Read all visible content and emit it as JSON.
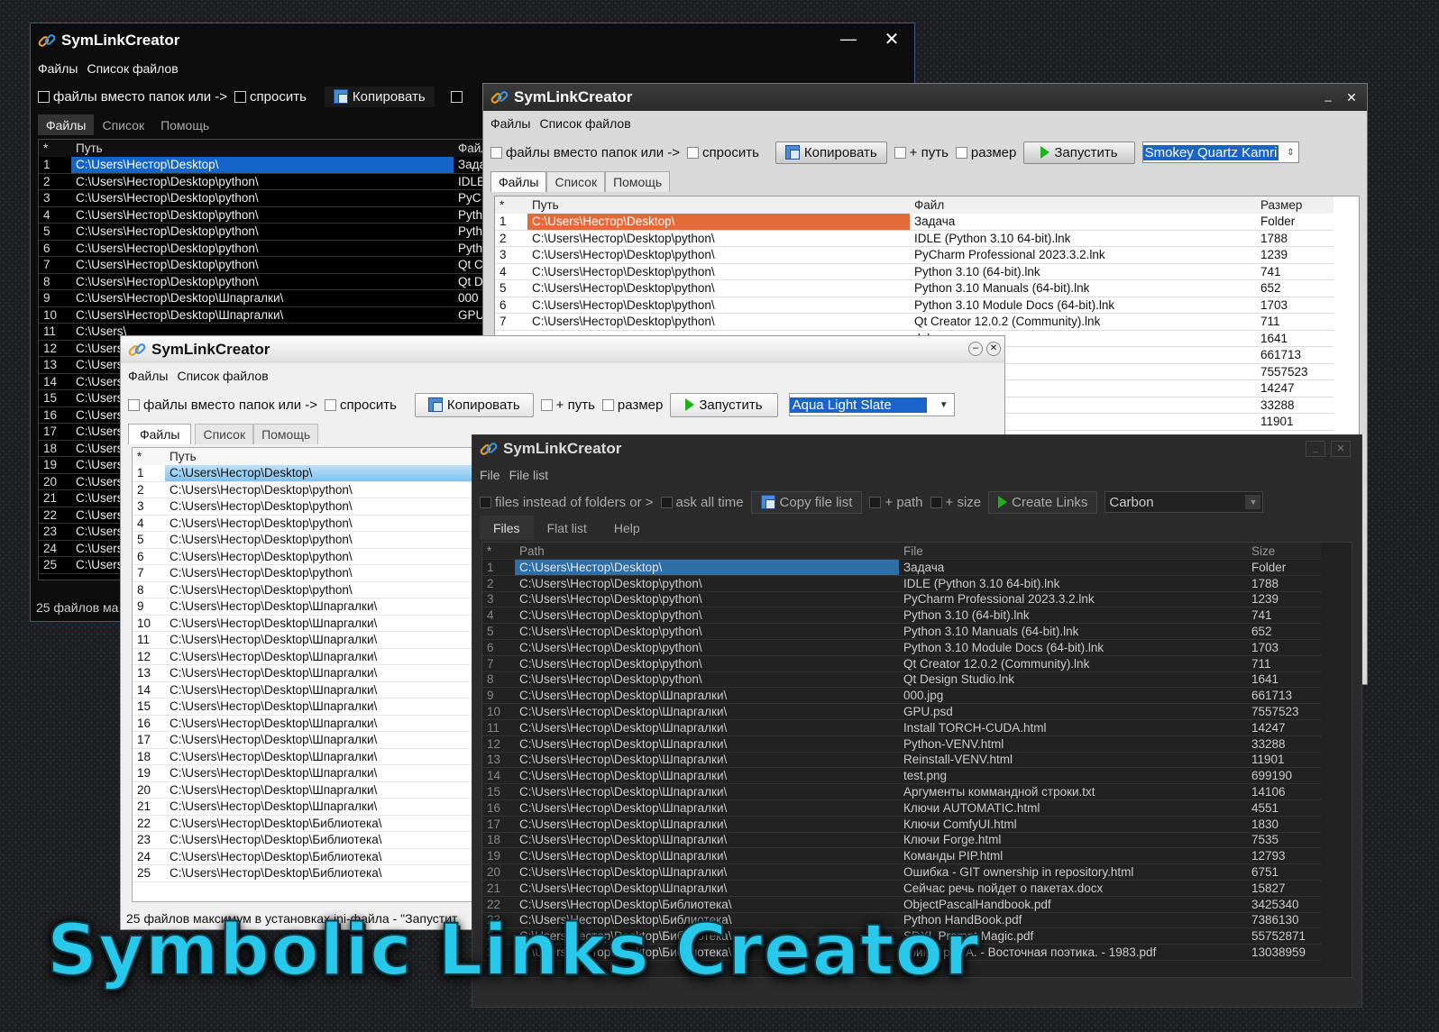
{
  "app_title": "SymLinkCreator",
  "watermark": "Symbolic Links Creator",
  "ru": {
    "menu": [
      "Файлы",
      "Список файлов"
    ],
    "files_instead": "файлы вместо папок или ->",
    "ask": "спросить",
    "copy": "Копировать",
    "plus_path": "+ путь",
    "size": "размер",
    "run": "Запустить",
    "tabs": [
      "Файлы",
      "Список",
      "Помощь"
    ],
    "col_path": "Путь",
    "col_file": "Файл",
    "col_size": "Размер"
  },
  "w1": {
    "paths": [
      "C:\\Users\\Нестор\\Desktop\\",
      "C:\\Users\\Нестор\\Desktop\\python\\",
      "C:\\Users\\Нестор\\Desktop\\python\\",
      "C:\\Users\\Нестор\\Desktop\\python\\",
      "C:\\Users\\Нестор\\Desktop\\python\\",
      "C:\\Users\\Нестор\\Desktop\\python\\",
      "C:\\Users\\Нестор\\Desktop\\python\\",
      "C:\\Users\\Нестор\\Desktop\\python\\",
      "C:\\Users\\Нестор\\Desktop\\Шпаргалки\\",
      "C:\\Users\\Нестор\\Desktop\\Шпаргалки\\",
      "C:\\Users\\",
      "C:\\Users\\",
      "C:\\Users\\",
      "C:\\Users\\",
      "C:\\Users\\",
      "C:\\Users\\",
      "C:\\Users\\",
      "C:\\Users\\",
      "C:\\Users\\",
      "C:\\Users\\",
      "C:\\Users\\",
      "C:\\Users\\",
      "C:\\Users\\",
      "C:\\Users\\",
      "C:\\Users\\"
    ],
    "files": [
      "Зада",
      "IDLE",
      "PyC",
      "Pyth",
      "Pyth",
      "Pyth",
      "Qt C",
      "Qt D",
      "000",
      "GPU",
      "",
      "",
      "",
      "",
      "",
      "",
      "",
      "",
      "",
      "",
      "",
      "",
      "",
      "",
      ""
    ],
    "status": "25 файлов ма"
  },
  "w2": {
    "theme": "Smokey Quartz Kamri",
    "rows": [
      {
        "n": "1",
        "path": "C:\\Users\\Нестор\\Desktop\\",
        "file": "Задача",
        "size": "Folder"
      },
      {
        "n": "2",
        "path": "C:\\Users\\Нестор\\Desktop\\python\\",
        "file": "IDLE (Python 3.10 64-bit).lnk",
        "size": "1788"
      },
      {
        "n": "3",
        "path": "C:\\Users\\Нестор\\Desktop\\python\\",
        "file": "PyCharm Professional 2023.3.2.lnk",
        "size": "1239"
      },
      {
        "n": "4",
        "path": "C:\\Users\\Нестор\\Desktop\\python\\",
        "file": "Python 3.10 (64-bit).lnk",
        "size": "741"
      },
      {
        "n": "5",
        "path": "C:\\Users\\Нестор\\Desktop\\python\\",
        "file": "Python 3.10 Manuals (64-bit).lnk",
        "size": "652"
      },
      {
        "n": "6",
        "path": "C:\\Users\\Нестор\\Desktop\\python\\",
        "file": "Python 3.10 Module Docs (64-bit).lnk",
        "size": "1703"
      },
      {
        "n": "7",
        "path": "C:\\Users\\Нестор\\Desktop\\python\\",
        "file": "Qt Creator 12.0.2 (Community).lnk",
        "size": "711"
      },
      {
        "n": "",
        "path": "",
        "file": ".lnk",
        "size": "1641"
      },
      {
        "n": "",
        "path": "",
        "file": "",
        "size": "661713"
      },
      {
        "n": "",
        "path": "",
        "file": "",
        "size": "7557523"
      },
      {
        "n": "",
        "path": "",
        "file": "UDA.html",
        "size": "14247"
      },
      {
        "n": "",
        "path": "",
        "file": "l",
        "size": "33288"
      },
      {
        "n": "",
        "path": "",
        "file": "ml",
        "size": "11901"
      }
    ]
  },
  "w3": {
    "theme": "Aqua Light Slate",
    "paths": [
      "C:\\Users\\Нестор\\Desktop\\",
      "C:\\Users\\Нестор\\Desktop\\python\\",
      "C:\\Users\\Нестор\\Desktop\\python\\",
      "C:\\Users\\Нестор\\Desktop\\python\\",
      "C:\\Users\\Нестор\\Desktop\\python\\",
      "C:\\Users\\Нестор\\Desktop\\python\\",
      "C:\\Users\\Нестор\\Desktop\\python\\",
      "C:\\Users\\Нестор\\Desktop\\python\\",
      "C:\\Users\\Нестор\\Desktop\\Шпаргалки\\",
      "C:\\Users\\Нестор\\Desktop\\Шпаргалки\\",
      "C:\\Users\\Нестор\\Desktop\\Шпаргалки\\",
      "C:\\Users\\Нестор\\Desktop\\Шпаргалки\\",
      "C:\\Users\\Нестор\\Desktop\\Шпаргалки\\",
      "C:\\Users\\Нестор\\Desktop\\Шпаргалки\\",
      "C:\\Users\\Нестор\\Desktop\\Шпаргалки\\",
      "C:\\Users\\Нестор\\Desktop\\Шпаргалки\\",
      "C:\\Users\\Нестор\\Desktop\\Шпаргалки\\",
      "C:\\Users\\Нестор\\Desktop\\Шпаргалки\\",
      "C:\\Users\\Нестор\\Desktop\\Шпаргалки\\",
      "C:\\Users\\Нестор\\Desktop\\Шпаргалки\\",
      "C:\\Users\\Нестор\\Desktop\\Шпаргалки\\",
      "C:\\Users\\Нестор\\Desktop\\Библиотека\\",
      "C:\\Users\\Нестор\\Desktop\\Библиотека\\",
      "C:\\Users\\Нестор\\Desktop\\Библиотека\\",
      "C:\\Users\\Нестор\\Desktop\\Библиотека\\"
    ],
    "status": "25 файлов максимум в установках ini-файла - \"Запустит"
  },
  "w4": {
    "menu": [
      "File",
      "File list"
    ],
    "files_instead": "files instead of folders or >",
    "ask": "ask all time",
    "copy": "Copy file list",
    "plus_path": "+ path",
    "size": "+ size",
    "run": "Create Links",
    "theme": "Carbon",
    "tabs": [
      "Files",
      "Flat list",
      "Help"
    ],
    "col_path": "Path",
    "col_file": "File",
    "col_size": "Size",
    "rows": [
      {
        "n": "1",
        "path": "C:\\Users\\Нестор\\Desktop\\",
        "file": "Задача",
        "size": "Folder"
      },
      {
        "n": "2",
        "path": "C:\\Users\\Нестор\\Desktop\\python\\",
        "file": "IDLE (Python 3.10 64-bit).lnk",
        "size": "1788"
      },
      {
        "n": "3",
        "path": "C:\\Users\\Нестор\\Desktop\\python\\",
        "file": "PyCharm Professional 2023.3.2.lnk",
        "size": "1239"
      },
      {
        "n": "4",
        "path": "C:\\Users\\Нестор\\Desktop\\python\\",
        "file": "Python 3.10 (64-bit).lnk",
        "size": "741"
      },
      {
        "n": "5",
        "path": "C:\\Users\\Нестор\\Desktop\\python\\",
        "file": "Python 3.10 Manuals (64-bit).lnk",
        "size": "652"
      },
      {
        "n": "6",
        "path": "C:\\Users\\Нестор\\Desktop\\python\\",
        "file": "Python 3.10 Module Docs (64-bit).lnk",
        "size": "1703"
      },
      {
        "n": "7",
        "path": "C:\\Users\\Нестор\\Desktop\\python\\",
        "file": "Qt Creator 12.0.2 (Community).lnk",
        "size": "711"
      },
      {
        "n": "8",
        "path": "C:\\Users\\Нестор\\Desktop\\python\\",
        "file": "Qt Design Studio.lnk",
        "size": "1641"
      },
      {
        "n": "9",
        "path": "C:\\Users\\Нестор\\Desktop\\Шпаргалки\\",
        "file": "000.jpg",
        "size": "661713"
      },
      {
        "n": "10",
        "path": "C:\\Users\\Нестор\\Desktop\\Шпаргалки\\",
        "file": "GPU.psd",
        "size": "7557523"
      },
      {
        "n": "11",
        "path": "C:\\Users\\Нестор\\Desktop\\Шпаргалки\\",
        "file": "Install TORCH-CUDA.html",
        "size": "14247"
      },
      {
        "n": "12",
        "path": "C:\\Users\\Нестор\\Desktop\\Шпаргалки\\",
        "file": "Python-VENV.html",
        "size": "33288"
      },
      {
        "n": "13",
        "path": "C:\\Users\\Нестор\\Desktop\\Шпаргалки\\",
        "file": "Reinstall-VENV.html",
        "size": "11901"
      },
      {
        "n": "14",
        "path": "C:\\Users\\Нестор\\Desktop\\Шпаргалки\\",
        "file": "test.png",
        "size": "699190"
      },
      {
        "n": "15",
        "path": "C:\\Users\\Нестор\\Desktop\\Шпаргалки\\",
        "file": "Аргументы коммандной строки.txt",
        "size": "14106"
      },
      {
        "n": "16",
        "path": "C:\\Users\\Нестор\\Desktop\\Шпаргалки\\",
        "file": "Ключи AUTOMATIC.html",
        "size": "4551"
      },
      {
        "n": "17",
        "path": "C:\\Users\\Нестор\\Desktop\\Шпаргалки\\",
        "file": "Ключи ComfyUI.html",
        "size": "1830"
      },
      {
        "n": "18",
        "path": "C:\\Users\\Нестор\\Desktop\\Шпаргалки\\",
        "file": "Ключи Forge.html",
        "size": "7535"
      },
      {
        "n": "19",
        "path": "C:\\Users\\Нестор\\Desktop\\Шпаргалки\\",
        "file": "Команды PIP.html",
        "size": "12793"
      },
      {
        "n": "20",
        "path": "C:\\Users\\Нестор\\Desktop\\Шпаргалки\\",
        "file": "Ошибка - GIT ownership in repository.html",
        "size": "6751"
      },
      {
        "n": "21",
        "path": "C:\\Users\\Нестор\\Desktop\\Шпаргалки\\",
        "file": "Сейчас речь пойдет о пакетах.docx",
        "size": "15827"
      },
      {
        "n": "22",
        "path": "C:\\Users\\Нестор\\Desktop\\Библиотека\\",
        "file": "ObjectPascalHandbook.pdf",
        "size": "3425340"
      },
      {
        "n": "23",
        "path": "C:\\Users\\Нестор\\Desktop\\Библиотека\\",
        "file": "Python HandBook.pdf",
        "size": "7386130"
      },
      {
        "n": "24",
        "path": "C:\\Users\\Нестор\\Desktop\\Библиотека\\",
        "file": "SDXL Prompt Magic.pdf",
        "size": "55752871"
      },
      {
        "n": "25",
        "path": "C:\\Users\\Нестор\\Desktop\\Библиотека\\",
        "file": "Гринцер П.А. - Восточная поэтика. - 1983.pdf",
        "size": "13038959"
      }
    ]
  }
}
